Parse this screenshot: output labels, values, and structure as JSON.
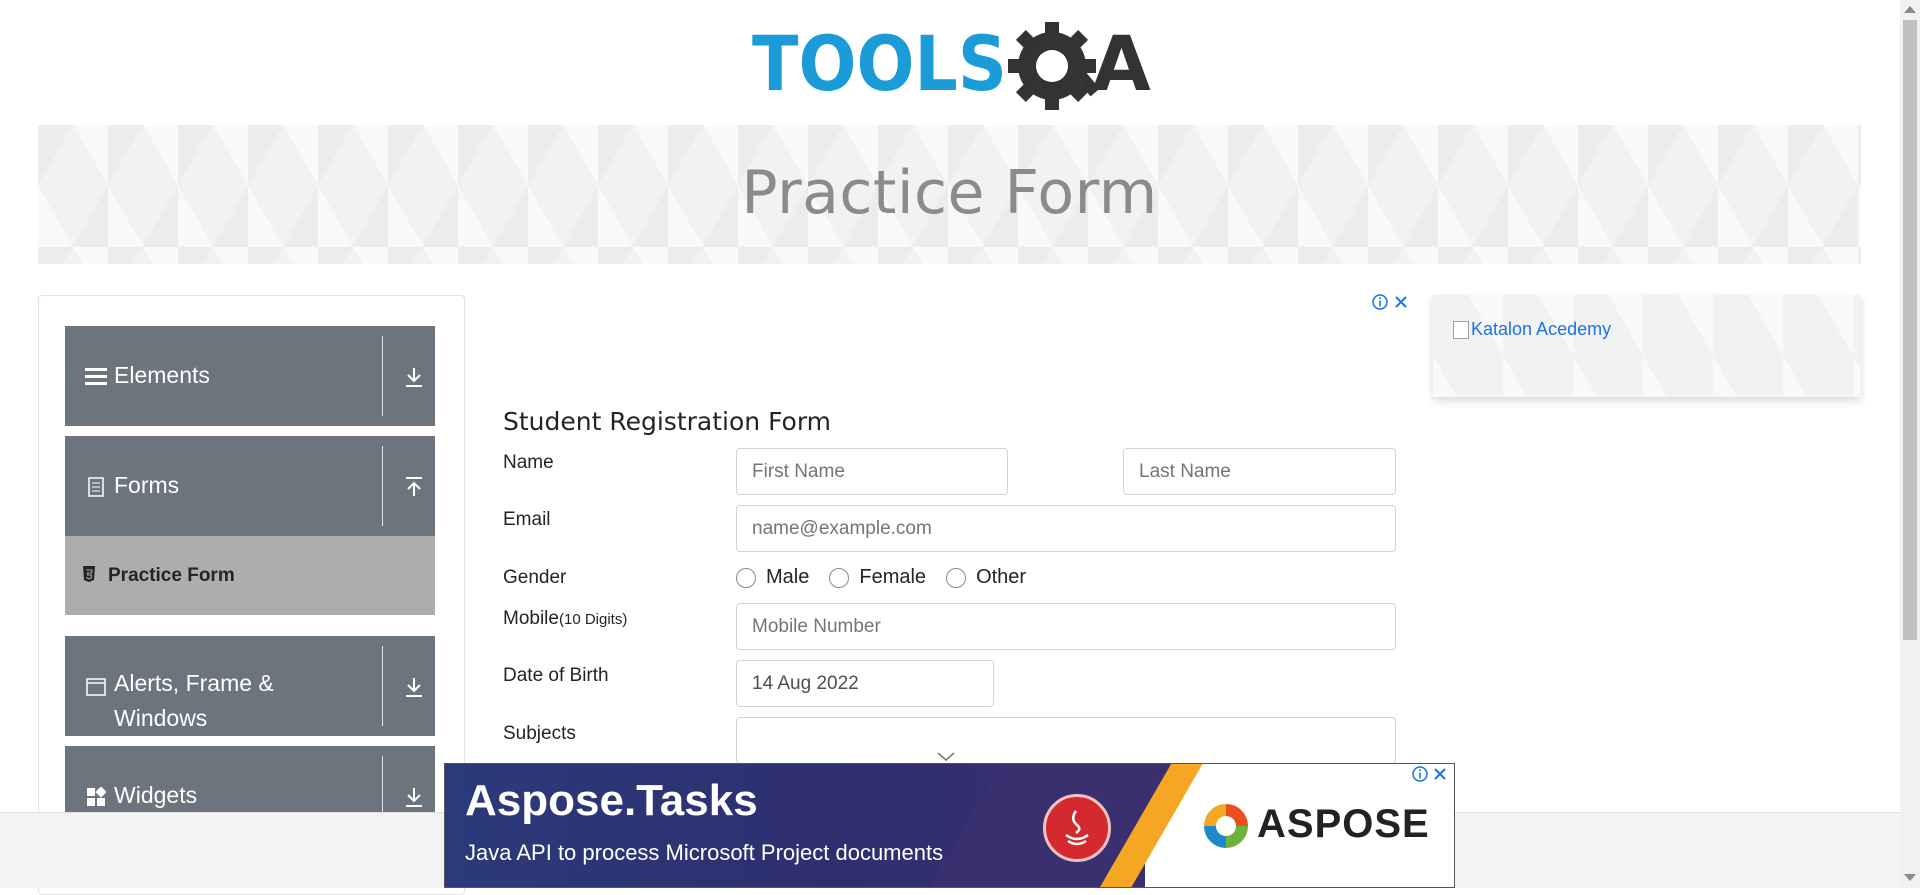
{
  "header": {
    "logo_text": "TOOLSQA",
    "page_title": "Practice Form"
  },
  "sidebar": {
    "groups": [
      {
        "label": "Elements",
        "icon": "hamburger-icon",
        "arrow": "download-arrow-icon"
      },
      {
        "label": "Forms",
        "icon": "document-icon",
        "arrow": "upload-arrow-icon"
      },
      {
        "label": "Alerts, Frame & Windows",
        "icon": "window-icon",
        "arrow": "download-arrow-icon"
      },
      {
        "label": "Widgets",
        "icon": "widgets-icon",
        "arrow": "download-arrow-icon"
      }
    ],
    "active_item": {
      "label": "Practice Form",
      "icon": "html5-icon"
    }
  },
  "side_ad": {
    "alt_text": "Katalon Acedemy"
  },
  "form": {
    "title": "Student Registration Form",
    "name": {
      "label": "Name",
      "first_placeholder": "First Name",
      "last_placeholder": "Last Name"
    },
    "email": {
      "label": "Email",
      "placeholder": "name@example.com"
    },
    "gender": {
      "label": "Gender",
      "options": [
        "Male",
        "Female",
        "Other"
      ]
    },
    "mobile": {
      "label": "Mobile",
      "hint": "(10 Digits)",
      "placeholder": "Mobile Number"
    },
    "dob": {
      "label": "Date of Birth",
      "value": "14 Aug 2022"
    },
    "subjects": {
      "label": "Subjects"
    }
  },
  "bottom_ad": {
    "title": "Aspose.Tasks",
    "subtitle": "Java API to process Microsoft Project documents",
    "brand": "ASPOSE"
  },
  "colors": {
    "sidebar_header": "#6c757d",
    "sidebar_active": "#adadad",
    "logo_blue": "#1b9bd7",
    "logo_dark": "#333333"
  }
}
